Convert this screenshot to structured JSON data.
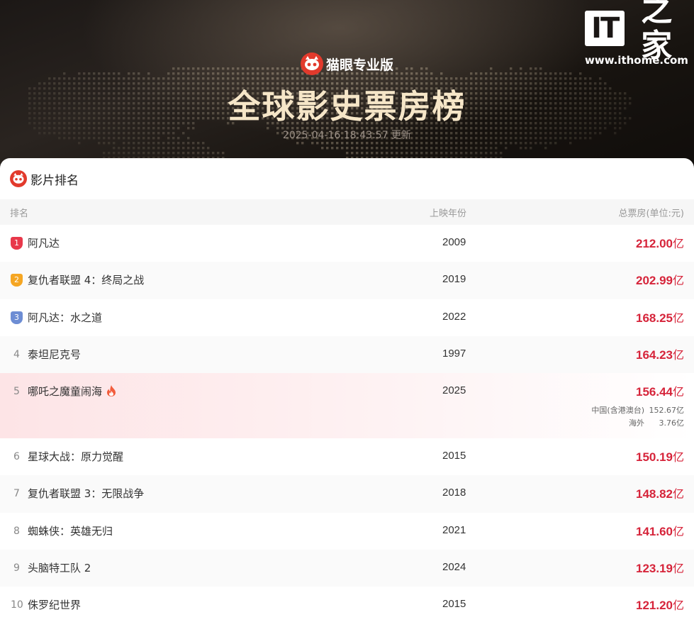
{
  "watermark": {
    "logo_it": "IT",
    "logo_zh": "之家",
    "url": "www.ithome.com"
  },
  "header": {
    "brand": "猫眼专业版",
    "title": "全球影史票房榜",
    "updated": "2025-04-16 18:43:57 更新"
  },
  "section": {
    "title": "影片排名"
  },
  "columns": {
    "rank": "排名",
    "year": "上映年份",
    "total": "总票房(单位:元)"
  },
  "unit": "亿",
  "movies": [
    {
      "rank": "1",
      "name": "阿凡达",
      "year": "2009",
      "box": "212.00"
    },
    {
      "rank": "2",
      "name": "复仇者联盟 4：终局之战",
      "year": "2019",
      "box": "202.99"
    },
    {
      "rank": "3",
      "name": "阿凡达：水之道",
      "year": "2022",
      "box": "168.25"
    },
    {
      "rank": "4",
      "name": "泰坦尼克号",
      "year": "1997",
      "box": "164.23"
    },
    {
      "rank": "5",
      "name": "哪吒之魔童闹海",
      "year": "2025",
      "box": "156.44",
      "detail": [
        {
          "label": "中国(含港澳台)",
          "value": "152.67亿"
        },
        {
          "label": "海外",
          "value": "3.76亿"
        }
      ]
    },
    {
      "rank": "6",
      "name": "星球大战：原力觉醒",
      "year": "2015",
      "box": "150.19"
    },
    {
      "rank": "7",
      "name": "复仇者联盟 3：无限战争",
      "year": "2018",
      "box": "148.82"
    },
    {
      "rank": "8",
      "name": "蜘蛛侠：英雄无归",
      "year": "2021",
      "box": "141.60"
    },
    {
      "rank": "9",
      "name": "头脑特工队 2",
      "year": "2024",
      "box": "123.19"
    },
    {
      "rank": "10",
      "name": "侏罗纪世界",
      "year": "2015",
      "box": "121.20"
    }
  ],
  "colors": {
    "accent_red": "#d6243a",
    "gold_title": "#f6e6c8",
    "badge_1": "#e8384a",
    "badge_2": "#f5a623",
    "badge_3": "#6d8dd4"
  },
  "icons": {
    "brand": "maoyan-cat-icon",
    "hot": "fire-icon"
  }
}
